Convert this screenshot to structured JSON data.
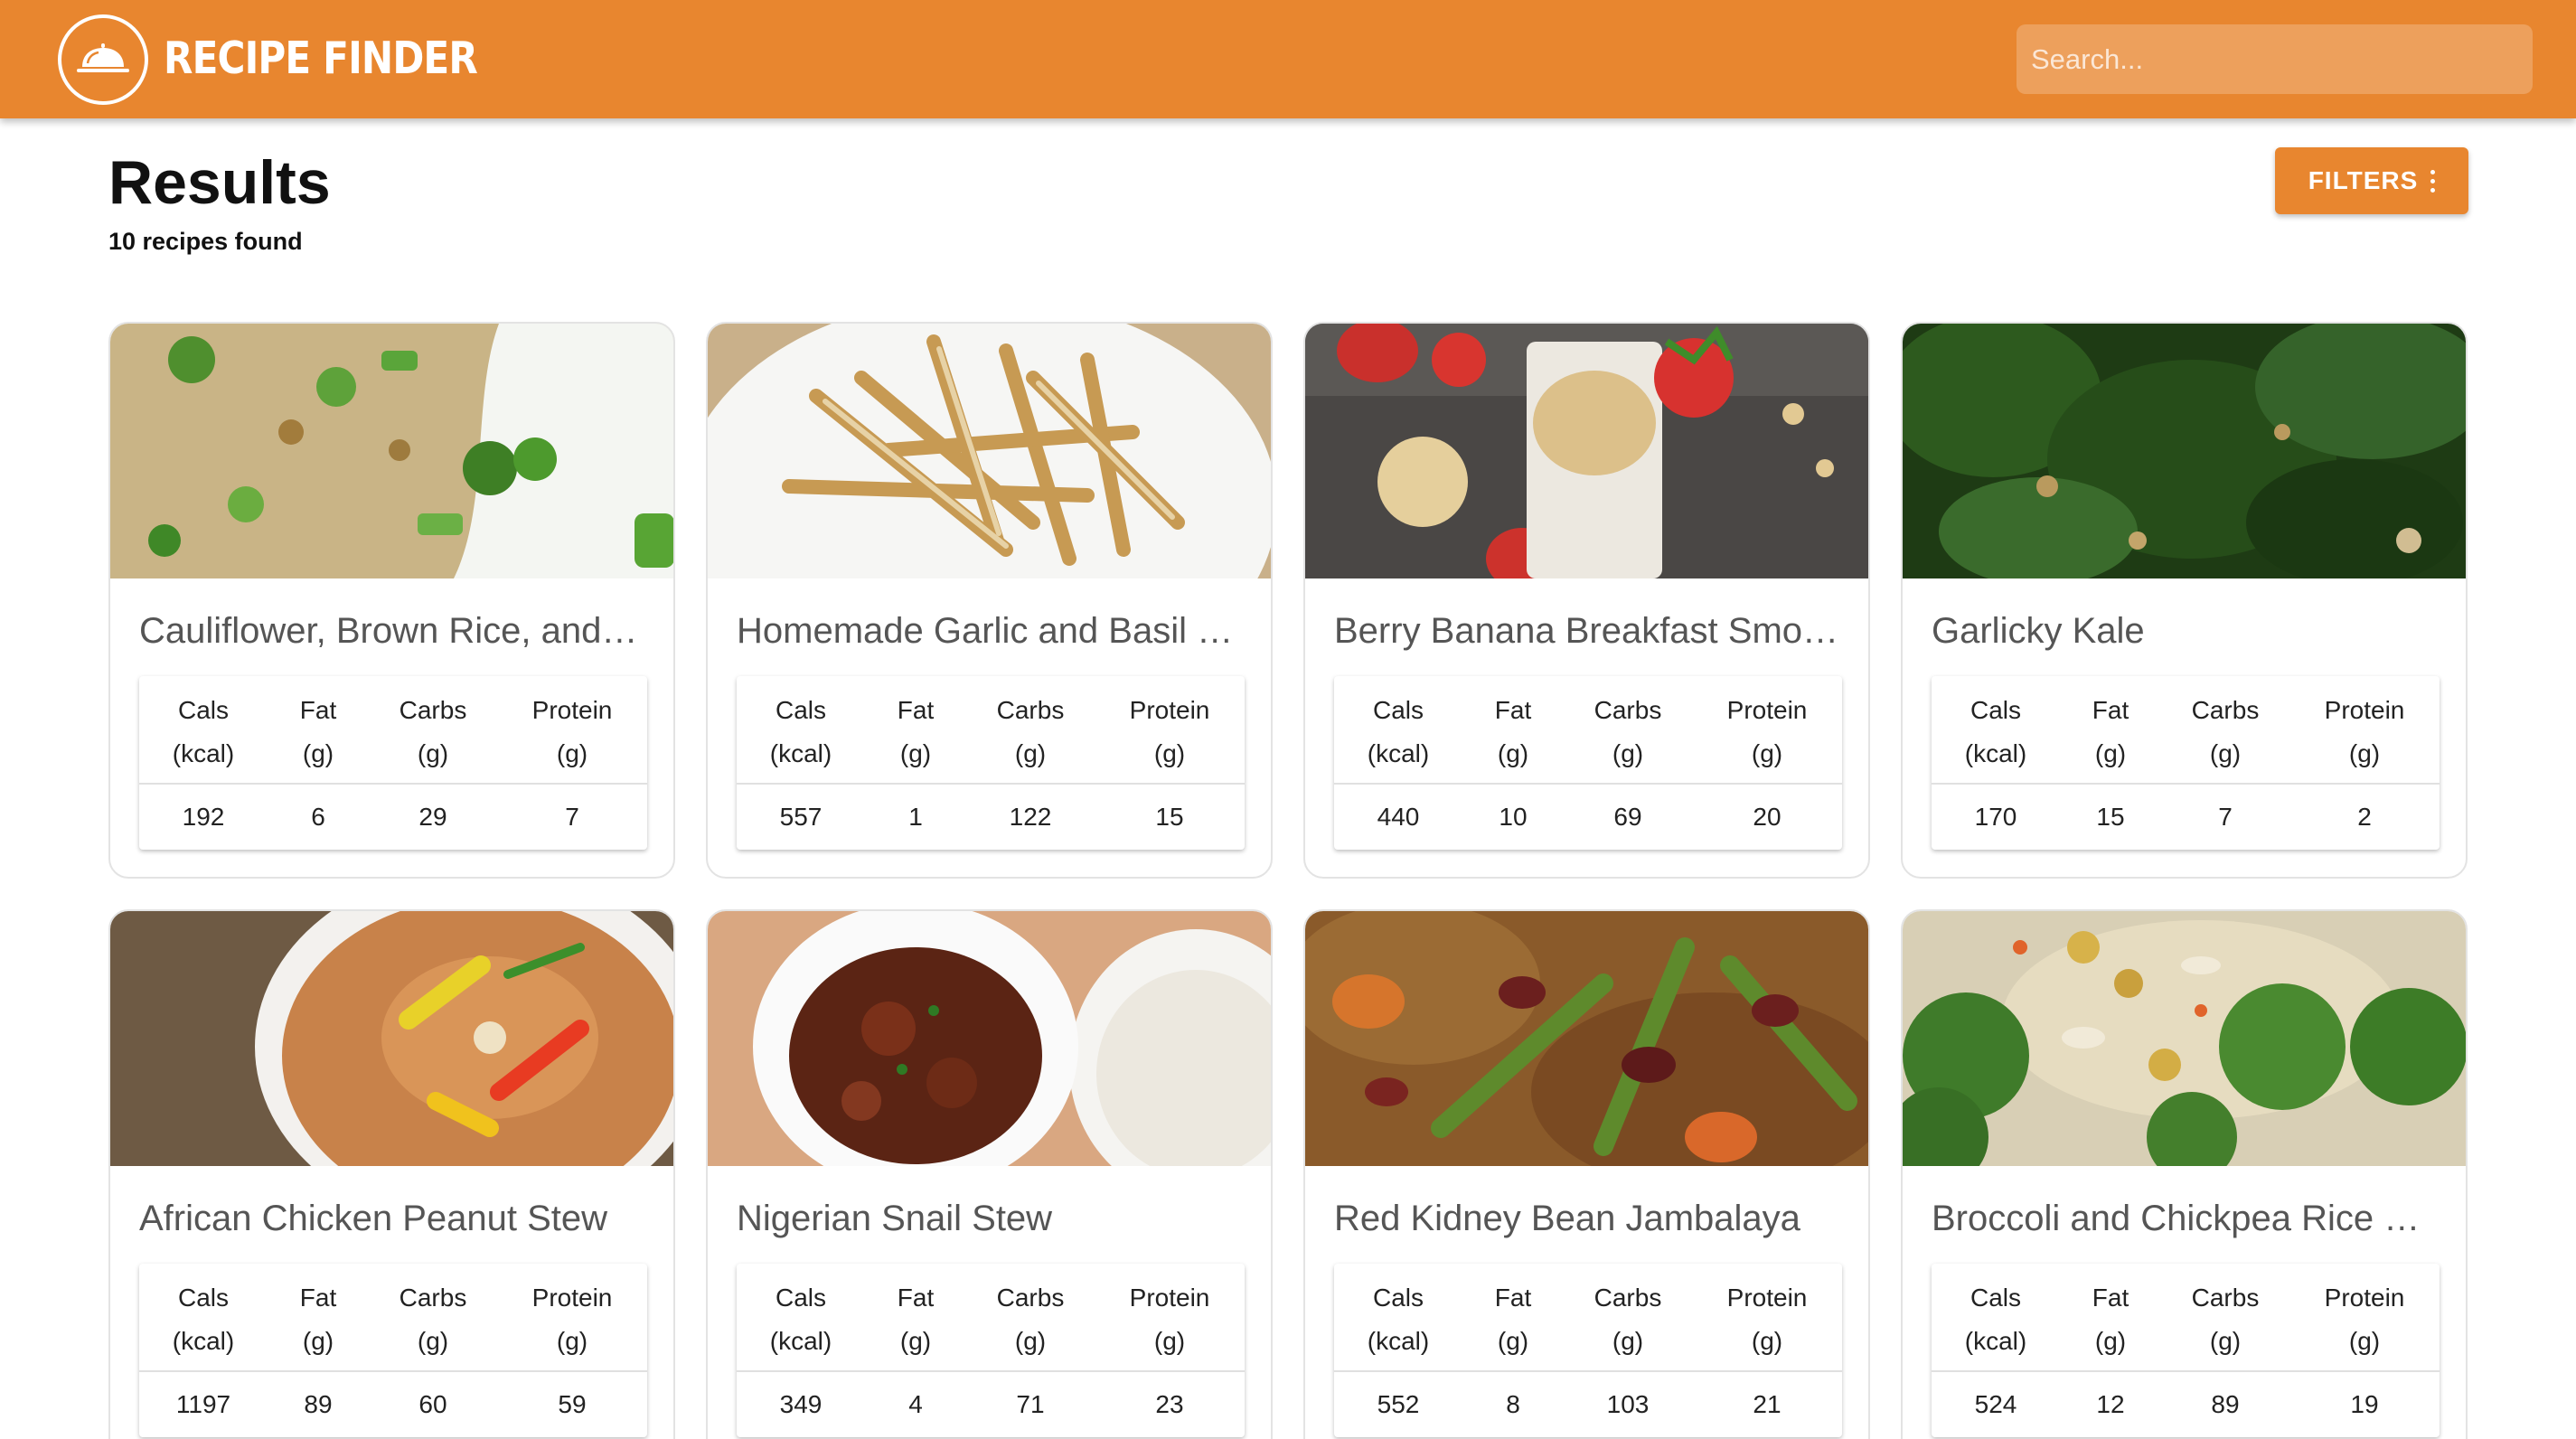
{
  "header": {
    "brand": "RECIPE FINDER",
    "search_placeholder": "Search..."
  },
  "results": {
    "title": "Results",
    "count_text": "10 recipes found",
    "filters_label": "FILTERS"
  },
  "nutrition_headers": {
    "cals": [
      "Cals",
      "(kcal)"
    ],
    "fat": [
      "Fat",
      "(g)"
    ],
    "carbs": [
      "Carbs",
      "(g)"
    ],
    "protein": [
      "Protein",
      "(g)"
    ]
  },
  "recipes": [
    {
      "title": "Cauliflower, Brown Rice, and Vegetable Fried Rice",
      "cals": "192",
      "fat": "6",
      "carbs": "29",
      "protein": "7"
    },
    {
      "title": "Homemade Garlic and Basil French Fries",
      "cals": "557",
      "fat": "1",
      "carbs": "122",
      "protein": "15"
    },
    {
      "title": "Berry Banana Breakfast Smoothie",
      "cals": "440",
      "fat": "10",
      "carbs": "69",
      "protein": "20"
    },
    {
      "title": "Garlicky Kale",
      "cals": "170",
      "fat": "15",
      "carbs": "7",
      "protein": "2"
    },
    {
      "title": "African Chicken Peanut Stew",
      "cals": "1197",
      "fat": "89",
      "carbs": "60",
      "protein": "59"
    },
    {
      "title": "Nigerian Snail Stew",
      "cals": "349",
      "fat": "4",
      "carbs": "71",
      "protein": "23"
    },
    {
      "title": "Red Kidney Bean Jambalaya",
      "cals": "552",
      "fat": "8",
      "carbs": "103",
      "protein": "21"
    },
    {
      "title": "Broccoli and Chickpea Rice Salad",
      "cals": "524",
      "fat": "12",
      "carbs": "89",
      "protein": "19"
    }
  ],
  "colors": {
    "accent": "#e8862f",
    "card_border": "#e3e3e3",
    "title_text": "#555555"
  },
  "icons": {
    "logo": "serving-cloche-icon",
    "filters": "more-vertical-icon"
  }
}
